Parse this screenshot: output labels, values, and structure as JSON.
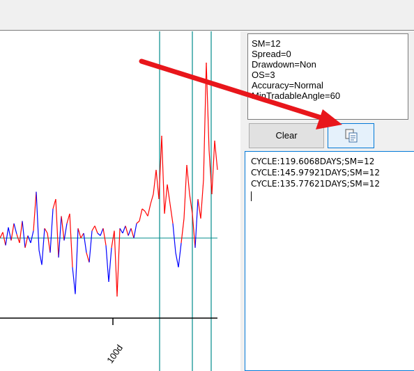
{
  "params": {
    "lines": [
      "SM=12",
      "Spread=0",
      "Drawdown=Non",
      "OS=3",
      "Accuracy=Normal",
      "MinTradableAngle=60"
    ]
  },
  "buttons": {
    "clear_label": "Clear",
    "copy_icon": "copy-icon"
  },
  "log": {
    "lines": [
      "CYCLE:119.6068DAYS;SM=12",
      "CYCLE:145.97921DAYS;SM=12",
      "CYCLE:135.77621DAYS;SM=12"
    ]
  },
  "annotation": {
    "arrow_color": "#e8161b"
  },
  "chart_data": {
    "type": "line",
    "x_tick_labels": [
      "100d"
    ],
    "colors": {
      "series_a": "#ff0000",
      "series_b": "#0000ff",
      "cycle_lines": "#008b8b",
      "baseline": "#008b8b",
      "axis": "#000000"
    },
    "series": [
      {
        "color_key": "series_a_b_alternating",
        "x": [
          0,
          4,
          8,
          12,
          16,
          20,
          24,
          28,
          32,
          36,
          40,
          44,
          48,
          52,
          56,
          60,
          64,
          68,
          72,
          76,
          80,
          84,
          88,
          92,
          96,
          100,
          104,
          108,
          112,
          116,
          120,
          124,
          128,
          132,
          136,
          140,
          144,
          148,
          152,
          156,
          160,
          164,
          168,
          172,
          176,
          180,
          184,
          188,
          192,
          196,
          200,
          204,
          208,
          212,
          216,
          220,
          224,
          228,
          232,
          236,
          240,
          244,
          248,
          252,
          256,
          260,
          264,
          268,
          272,
          276,
          280,
          284,
          288,
          292,
          296,
          300,
          304,
          308,
          312
        ],
        "y": [
          0.0,
          0.12,
          -0.15,
          0.22,
          -0.05,
          0.3,
          0.08,
          -0.1,
          0.35,
          -0.2,
          0.05,
          -0.1,
          0.15,
          0.95,
          -0.25,
          -0.55,
          0.2,
          0.1,
          -0.3,
          0.6,
          0.8,
          -0.4,
          0.45,
          -0.05,
          0.3,
          0.5,
          -0.6,
          -1.15,
          0.2,
          0.0,
          0.1,
          -0.3,
          -0.5,
          0.15,
          0.25,
          0.1,
          0.05,
          0.2,
          -0.15,
          -0.9,
          -0.2,
          0.15,
          -1.2,
          0.2,
          0.1,
          0.25,
          0.05,
          0.2,
          0.0,
          0.3,
          0.35,
          0.6,
          0.55,
          0.45,
          0.7,
          0.9,
          1.4,
          0.8,
          2.1,
          0.5,
          1.1,
          0.7,
          0.3,
          -0.3,
          -0.6,
          -0.1,
          0.4,
          1.5,
          0.9,
          0.5,
          -0.2,
          0.8,
          0.4,
          1.2,
          3.6,
          1.8,
          0.9,
          2.0,
          1.4
        ]
      }
    ],
    "ylim": [
      -1.4,
      3.2
    ],
    "cycle_marker_count": 3
  }
}
